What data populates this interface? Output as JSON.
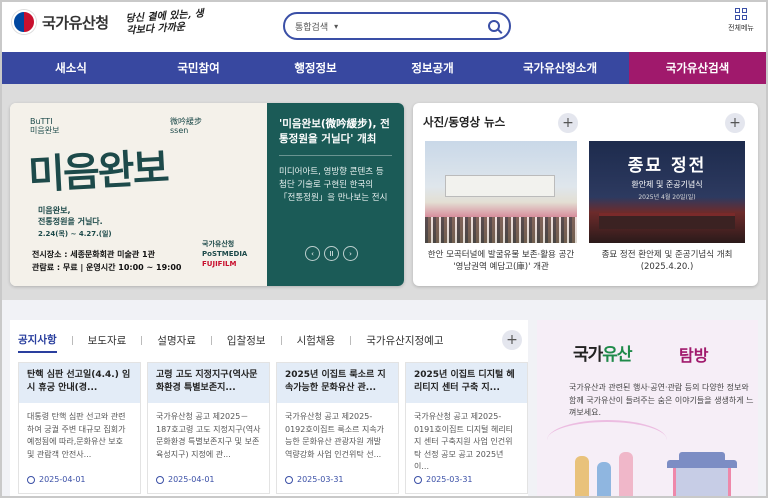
{
  "header": {
    "logo_text": "국가유산청",
    "slogan": "당신 곁에 있는, 생각보다 가까운",
    "search_scope": "통합검색",
    "all_menu_label": "전체메뉴"
  },
  "nav": {
    "items": [
      {
        "label": "새소식",
        "width": 138
      },
      {
        "label": "국민참여",
        "width": 117
      },
      {
        "label": "행정정보",
        "width": 117
      },
      {
        "label": "정보공개",
        "width": 117
      },
      {
        "label": "국가유산청소개",
        "width": 138
      },
      {
        "label": "국가유산검색",
        "width": 137,
        "active": true
      }
    ]
  },
  "banner": {
    "poster_title": "미음완보",
    "poster_small_left": "BuTTI 미음완보",
    "poster_small_right": "微吟緩步 ssen",
    "poster_sub": "미음완보,\n전통정원을 거닐다.",
    "poster_date": "2.24(목) ~ 4.27.(일)",
    "poster_venue": "전시장소 : 세종문화회관 미술관 1관\n관람료 : 무료 | 운영시간 10:00 ~ 19:00",
    "poster_logo1": "국가유산청",
    "poster_logo2": "PoSTMEDIA",
    "poster_logo3": "FUJIFILM",
    "title": "'미음완보(微吟緩步), 전통정원을 거닐다' 개최",
    "desc": "미디어아트, 영방향 콘텐츠 등 첨단 기술로 구현된 한국의 「전통정원」을 만나보는 전시",
    "controls": [
      "‹",
      "II",
      "›"
    ]
  },
  "news": {
    "title": "사진/동영상 뉴스",
    "img2_title": "종묘 정전",
    "img2_sub": "환안제 및 준공기념식",
    "img2_date": "2025년 4월 20일(일)",
    "caption1": "한안 모곡터널에 발굴유물 보존·활용 공간 '영남권역 예담고(庫)' 개관",
    "caption2": "종묘 정전 환안제 및 준공기념식 개최 (2025.4.20.)"
  },
  "notice": {
    "tabs": [
      "공지사항",
      "보도자료",
      "설명자료",
      "입찰정보",
      "시험채용",
      "국가유산지정예고"
    ],
    "cards": [
      {
        "title": "탄핵 심판 선고일(4.4.) 임시 휴궁 안내(경...",
        "body": "대통령 탄핵 심판 선고와 관련하여 궁궐 주변 대규모 집회가 예정됨에 따라,문화유산 보호 및 관람객 안전사...",
        "date": "2025-04-01"
      },
      {
        "title": "고령 고도 지정지구(역사문화환경 특별보존지...",
        "body": "국가유산청 공고 제2025－187호고령 고도 지정지구(역사문화환경 특별보존지구 및 보존육성지구) 지정에 관...",
        "date": "2025-04-01"
      },
      {
        "title": "2025년 이집트 룩소르 지속가능한 문화유산 관...",
        "body": "국가유산청 공고 제2025-0192호이집트 룩소르 지속가능한 문화유산 관광자원 개발 역량강화 사업 인건위탁 선...",
        "date": "2025-03-31"
      },
      {
        "title": "2025년 이집트 디지털 헤리티지 센터 구축 지...",
        "body": "국가유산청 공고 제2025-0191호이집트 디지털 헤리티지 센터 구축지원 사업 인건위탁 선정 공모 공고 2025년 이...",
        "date": "2025-03-31"
      }
    ]
  },
  "promo": {
    "title_part1": "국가",
    "title_accent": "유산",
    "title_part2": "탐방",
    "desc": "국가유산과 관련된 행사·공연·관람 등의 다양한 정보와 함께 국가유산이 들려주는 숨은 이야기들을 생생하게 느껴보세요."
  },
  "colors": {
    "nav_bg": "#3848a0",
    "nav_active": "#a0196c",
    "banner_panel": "#1b5b57",
    "accent_blue": "#2a3f9e"
  }
}
